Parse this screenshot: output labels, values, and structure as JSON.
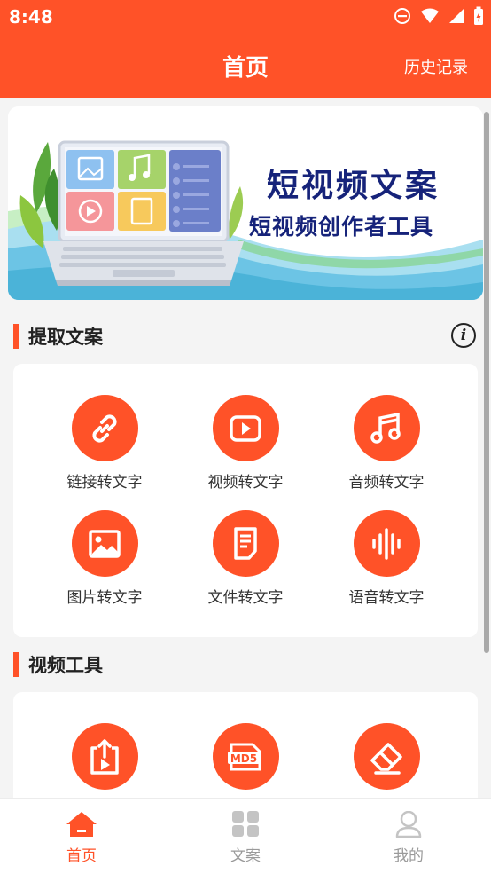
{
  "status_bar": {
    "time": "8:48"
  },
  "header": {
    "title": "首页",
    "history_label": "历史记录"
  },
  "banner": {
    "title": "短视频文案",
    "subtitle": "短视频创作者工具"
  },
  "sections": {
    "extract": {
      "title": "提取文案",
      "tools": [
        {
          "label": "链接转文字",
          "icon": "link-icon"
        },
        {
          "label": "视频转文字",
          "icon": "video-play-icon"
        },
        {
          "label": "音频转文字",
          "icon": "music-note-icon"
        },
        {
          "label": "图片转文字",
          "icon": "image-icon"
        },
        {
          "label": "文件转文字",
          "icon": "document-icon"
        },
        {
          "label": "语音转文字",
          "icon": "voice-wave-icon"
        }
      ]
    },
    "video_tools": {
      "title": "视频工具",
      "tools": [
        {
          "icon": "video-export-icon"
        },
        {
          "icon": "md5-icon",
          "badge_text": "MD5"
        },
        {
          "icon": "eraser-icon"
        }
      ]
    }
  },
  "bottom_nav": {
    "items": [
      {
        "label": "首页",
        "icon": "home-icon",
        "active": true
      },
      {
        "label": "文案",
        "icon": "grid-icon",
        "active": false
      },
      {
        "label": "我的",
        "icon": "user-icon",
        "active": false
      }
    ]
  },
  "colors": {
    "accent": "#ff5228",
    "inactive": "#9a9a9a",
    "banner_text": "#16237a"
  }
}
